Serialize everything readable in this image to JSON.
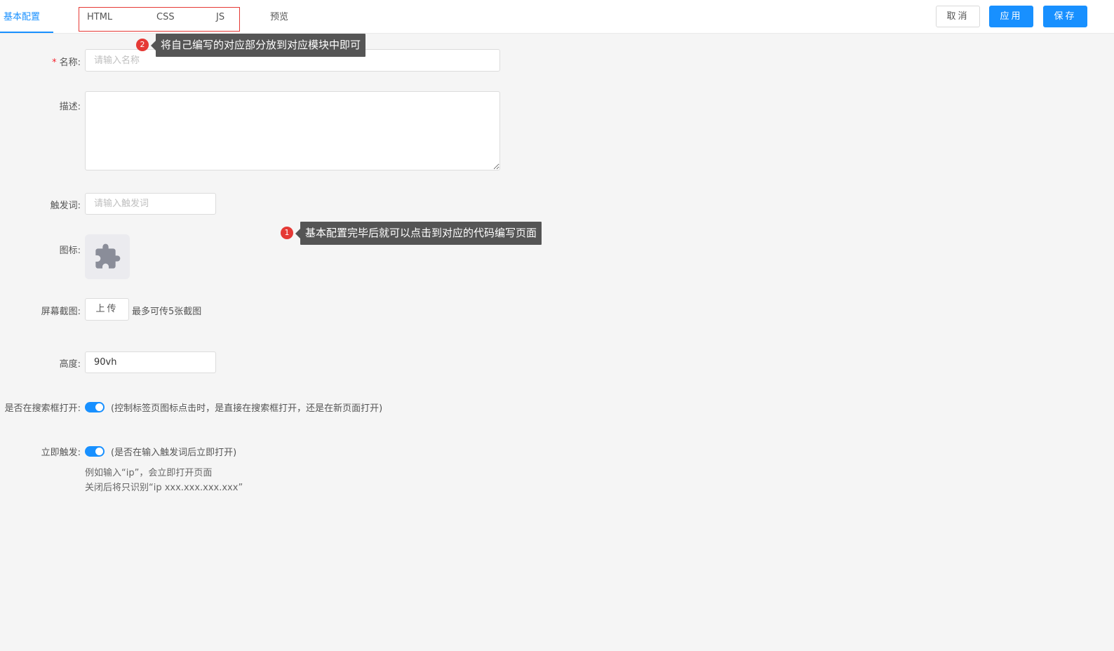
{
  "tabs": [
    "基本配置",
    "HTML",
    "CSS",
    "JS",
    "预览"
  ],
  "buttons": {
    "cancel": "取消",
    "apply": "应用",
    "save": "保存"
  },
  "form": {
    "name": {
      "label": "名称:",
      "required_mark": "*",
      "placeholder": "请输入名称",
      "value": ""
    },
    "description": {
      "label": "描述:",
      "value": ""
    },
    "trigger": {
      "label": "触发词:",
      "placeholder": "请输入触发词",
      "value": ""
    },
    "icon": {
      "label": "图标:",
      "icon_name": "puzzle-icon"
    },
    "screenshot": {
      "label": "屏幕截图:",
      "button": "上传",
      "hint": "最多可传5张截图"
    },
    "height": {
      "label": "高度:",
      "value": "90vh"
    },
    "open_in_search": {
      "label": "是否在搜索框打开:",
      "enabled": true,
      "hint": "(控制标签页图标点击时，是直接在搜索框打开，还是在新页面打开)"
    },
    "instant_trigger": {
      "label": "立即触发:",
      "enabled": true,
      "hint": "(是否在输入触发词后立即打开)",
      "example_line1": "例如输入“ip”，会立即打开页面",
      "example_line2": "关闭后将只识别“ip xxx.xxx.xxx.xxx”"
    }
  },
  "annotations": [
    {
      "number": "1",
      "text": "基本配置完毕后就可以点击到对应的代码编写页面"
    },
    {
      "number": "2",
      "text": "将自己编写的对应部分放到对应模块中即可"
    }
  ],
  "colors": {
    "accent": "#1890ff",
    "annotation_red": "#e53935",
    "callout_bg": "#555555"
  }
}
